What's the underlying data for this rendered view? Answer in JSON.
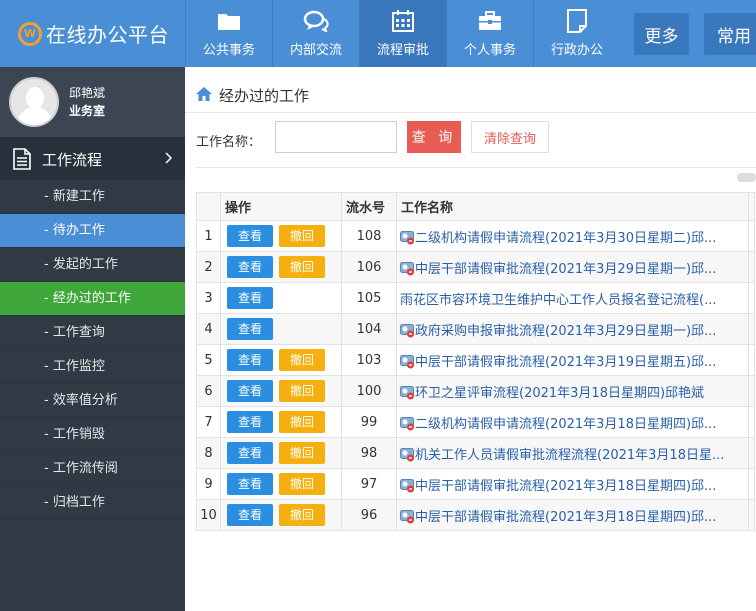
{
  "app": {
    "title": "在线办公平台",
    "logo_mark": "W"
  },
  "nav": {
    "items": [
      {
        "label": "公共事务",
        "icon": "folder-icon"
      },
      {
        "label": "内部交流",
        "icon": "chat-icon"
      },
      {
        "label": "流程审批",
        "icon": "calendar-icon",
        "active": true
      },
      {
        "label": "个人事务",
        "icon": "briefcase-icon"
      },
      {
        "label": "行政办公",
        "icon": "document-icon"
      }
    ],
    "more": "更多",
    "common": "常用"
  },
  "user": {
    "name": "邱艳斌",
    "dept": "业务室"
  },
  "sidebar": {
    "section": "工作流程",
    "items": [
      {
        "label": "- 新建工作"
      },
      {
        "label": "- 待办工作",
        "state": "highlight"
      },
      {
        "label": "- 发起的工作"
      },
      {
        "label": "- 经办过的工作",
        "state": "active"
      },
      {
        "label": "- 工作查询"
      },
      {
        "label": "- 工作监控"
      },
      {
        "label": "- 效率值分析"
      },
      {
        "label": "- 工作销毁"
      },
      {
        "label": "- 工作流传阅"
      },
      {
        "label": "- 归档工作"
      }
    ]
  },
  "page": {
    "title": "经办过的工作"
  },
  "search": {
    "label": "工作名称：",
    "value": "",
    "placeholder": "",
    "query_label": "查 询",
    "clear_label": "清除查询"
  },
  "table": {
    "columns": [
      "",
      "操作",
      "流水号",
      "工作名称",
      ""
    ],
    "view_label": "查看",
    "revoke_label": "撤回",
    "rows": [
      {
        "index": "1",
        "serial": "108",
        "name": "二级机构请假申请流程(2021年3月30日星期二)邱...",
        "revocable": true,
        "icon": true,
        "extra": ""
      },
      {
        "index": "2",
        "serial": "106",
        "name": "中层干部请假审批流程(2021年3月29日星期一)邱...",
        "revocable": true,
        "icon": true,
        "extra": ""
      },
      {
        "index": "3",
        "serial": "105",
        "name": "雨花区市容环境卫生维护中心工作人员报名登记流程(...",
        "revocable": false,
        "icon": false,
        "extra": ""
      },
      {
        "index": "4",
        "serial": "104",
        "name": "政府采购申报审批流程(2021年3月29日星期一)邱...",
        "revocable": false,
        "icon": true,
        "extra": ""
      },
      {
        "index": "5",
        "serial": "103",
        "name": "中层干部请假审批流程(2021年3月19日星期五)邱...",
        "revocable": true,
        "icon": true,
        "extra": ""
      },
      {
        "index": "6",
        "serial": "100",
        "name": "环卫之星评审流程(2021年3月18日星期四)邱艳斌",
        "revocable": true,
        "icon": true,
        "extra": ""
      },
      {
        "index": "7",
        "serial": "99",
        "name": "二级机构请假申请流程(2021年3月18日星期四)邱...",
        "revocable": true,
        "icon": true,
        "extra": ""
      },
      {
        "index": "8",
        "serial": "98",
        "name": "机关工作人员请假审批流程流程(2021年3月18日星...",
        "revocable": true,
        "icon": true,
        "extra": ""
      },
      {
        "index": "9",
        "serial": "97",
        "name": "中层干部请假审批流程(2021年3月18日星期四)邱...",
        "revocable": true,
        "icon": true,
        "extra": ""
      },
      {
        "index": "10",
        "serial": "96",
        "name": "中层干部请假审批流程(2021年3月18日星期四)邱...",
        "revocable": true,
        "icon": true,
        "extra": ""
      }
    ]
  },
  "colors": {
    "header": "#4a8fd6",
    "sidebar": "#2f3a45",
    "active_green": "#3fa63a",
    "view_btn": "#2b8ee0",
    "revoke_btn": "#f5b00f",
    "query_btn": "#e95b55",
    "link": "#2a5fa8"
  }
}
